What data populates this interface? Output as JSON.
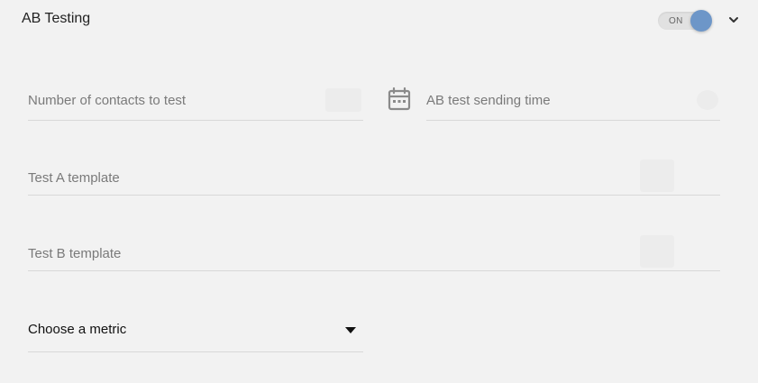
{
  "header": {
    "title": "AB Testing",
    "toggle_label": "ON",
    "toggle_on": true,
    "accent_color": "#6d96c8"
  },
  "fields": {
    "contacts": {
      "placeholder": "Number of contacts to test",
      "value": ""
    },
    "sending_time": {
      "placeholder": "AB test sending time",
      "value": "",
      "icon": "calendar-icon"
    },
    "template_a": {
      "placeholder": "Test A template",
      "value": ""
    },
    "template_b": {
      "placeholder": "Test B template",
      "value": ""
    }
  },
  "metric": {
    "selected": "Choose a metric",
    "icon": "caret-down-icon"
  }
}
